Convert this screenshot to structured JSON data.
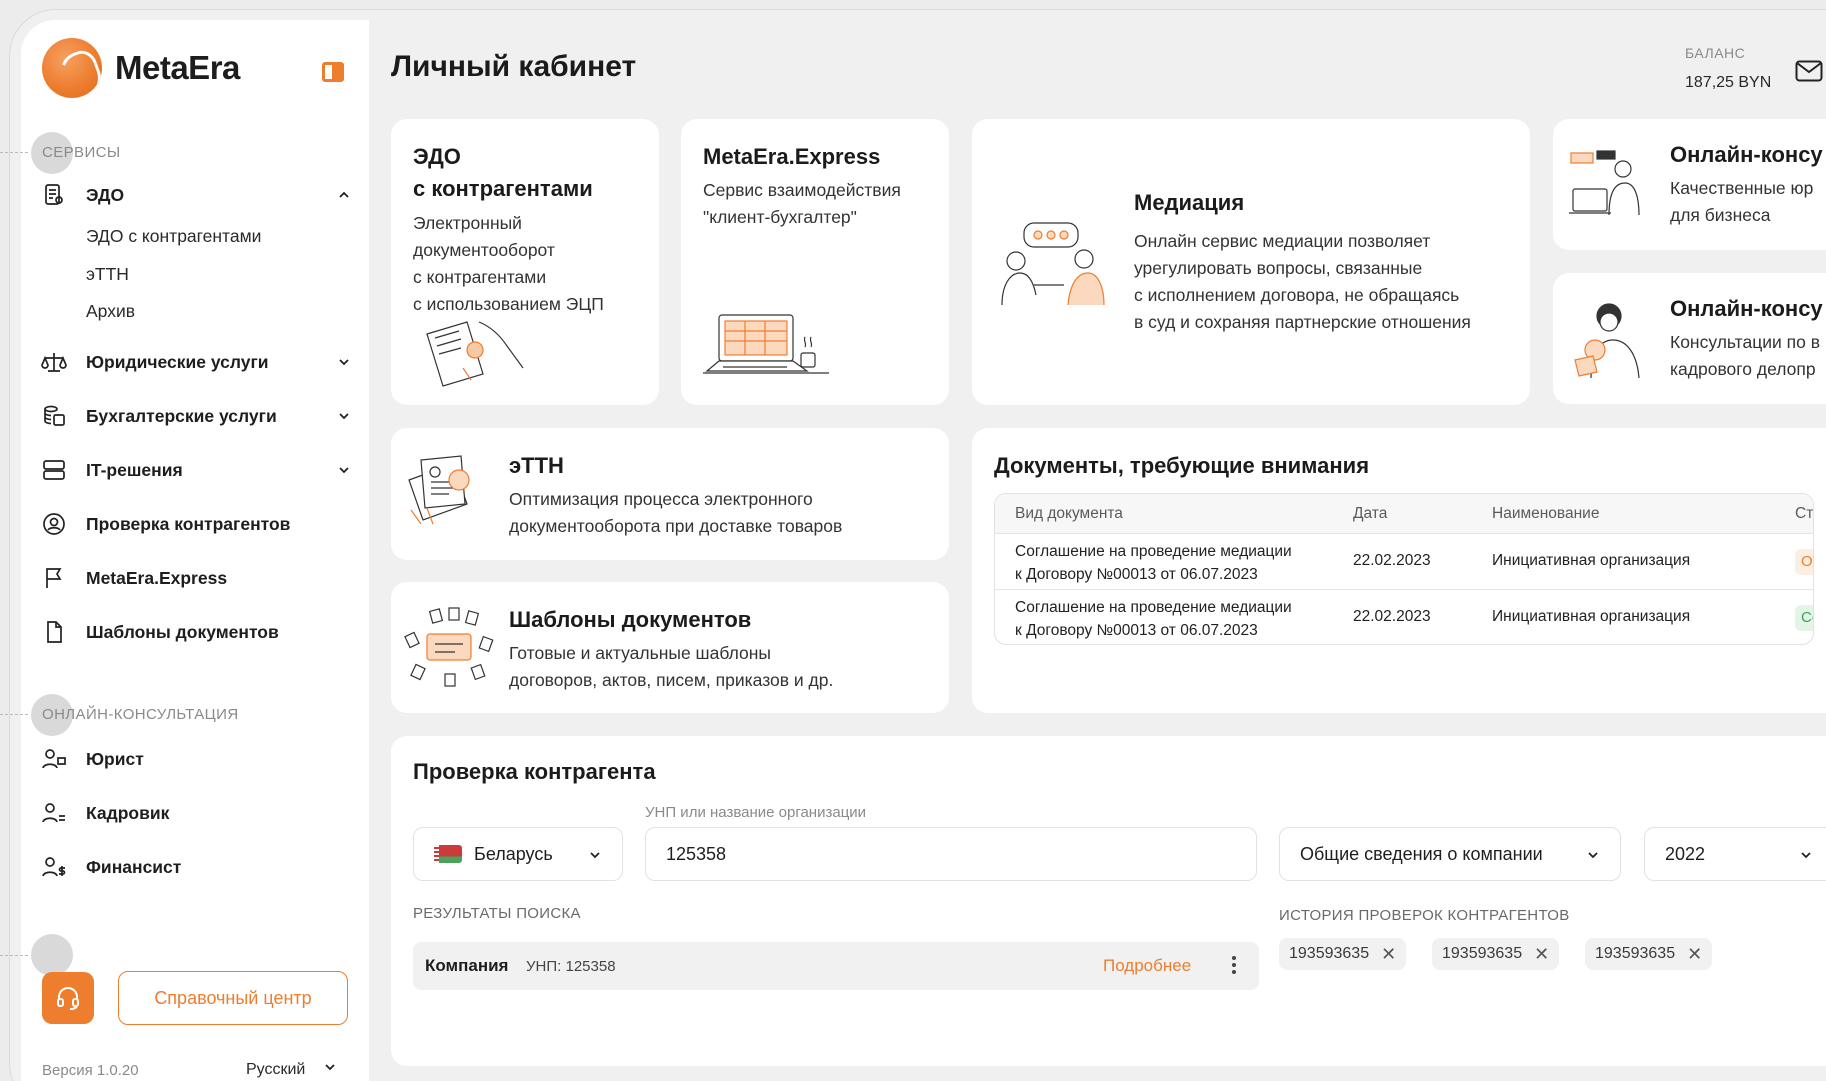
{
  "app": {
    "name": "MetaEra",
    "accent": "#ef7d2e"
  },
  "sidebar": {
    "services_label": "СЕРВИСЫ",
    "consult_label": "ОНЛАЙН-КОНСУЛЬТАЦИЯ",
    "edo": {
      "label": "ЭДО",
      "subitems": [
        "ЭДО с контрагентами",
        "эТТН",
        "Архив"
      ]
    },
    "items": [
      {
        "label": "Юридические услуги",
        "icon": "scales-icon"
      },
      {
        "label": "Бухгалтерские услуги",
        "icon": "coins-icon"
      },
      {
        "label": "IT-решения",
        "icon": "server-icon"
      },
      {
        "label": "Проверка контрагентов",
        "icon": "user-circle-icon"
      },
      {
        "label": "MetaEra.Express",
        "icon": "flag-icon"
      },
      {
        "label": "Шаблоны документов",
        "icon": "document-icon"
      }
    ],
    "consult_items": [
      {
        "label": "Юрист",
        "icon": "lawyer-icon"
      },
      {
        "label": "Кадровик",
        "icon": "hr-icon"
      },
      {
        "label": "Финансист",
        "icon": "finance-icon"
      }
    ],
    "help_center": "Справочный центр",
    "version": "Версия 1.0.20",
    "language": "Русский"
  },
  "header": {
    "title": "Личный кабинет",
    "balance_label": "БАЛАНС",
    "balance_value": "187,25 BYN"
  },
  "cards": {
    "edo": {
      "title_l1": "ЭДО",
      "title_l2": "с контрагентами",
      "desc": [
        "Электронный",
        "документооборот",
        "с контрагентами",
        "с использованием ЭЦП"
      ]
    },
    "express": {
      "title": "MetaEra.Express",
      "desc": [
        "Сервис взаимодействия",
        "\"клиент-бухгалтер\""
      ]
    },
    "mediation": {
      "title": "Медиация",
      "desc": [
        "Онлайн сервис медиации позволяет",
        "урегулировать вопросы, связанные",
        "с исполнением договора, не обращаясь",
        "в суд и сохраняя партнерские отношения"
      ]
    },
    "consult1": {
      "title": "Онлайн-консу",
      "desc": [
        "Качественные юр",
        "для бизнеса"
      ]
    },
    "consult2": {
      "title": "Онлайн-консу",
      "desc": [
        "Консультации по в",
        "кадрового делопр"
      ]
    },
    "ettn": {
      "title": "эТТН",
      "desc": [
        "Оптимизация процесса электронного",
        "документооборота при доставке товаров"
      ]
    },
    "templates": {
      "title": "Шаблоны документов",
      "desc": [
        "Готовые и актуальные шаблоны",
        "договоров, актов, писем, приказов и др."
      ]
    }
  },
  "documents": {
    "title": "Документы, требующие внимания",
    "columns": [
      "Вид документа",
      "Дата",
      "Наименование",
      "Ста"
    ],
    "rows": [
      {
        "type_l1": "Соглашение на проведение медиации",
        "type_l2": "к Договору №00013 от 06.07.2023",
        "date": "22.02.2023",
        "name": "Инициативная организация",
        "status": "Ож",
        "status_color": "#ef7d2e",
        "status_bg": "#fdeee2"
      },
      {
        "type_l1": "Соглашение на проведение медиации",
        "type_l2": "к Договору №00013 от 06.07.2023",
        "date": "22.02.2023",
        "name": "Инициативная организация",
        "status": "Со",
        "status_color": "#3aa55a",
        "status_bg": "#e4f5e8"
      }
    ]
  },
  "check": {
    "title": "Проверка контрагента",
    "country": "Беларусь",
    "unp_label": "УНП или название организации",
    "unp_value": "125358",
    "info_type": "Общие сведения о компании",
    "year": "2022",
    "results_label": "РЕЗУЛЬТАТЫ ПОИСКА",
    "result": {
      "name": "Компания",
      "unp": "УНП: 125358",
      "more": "Подробнее"
    },
    "history_label": "ИСТОРИЯ ПРОВЕРОК КОНТРАГЕНТОВ",
    "history": [
      "193593635",
      "193593635",
      "193593635"
    ]
  }
}
